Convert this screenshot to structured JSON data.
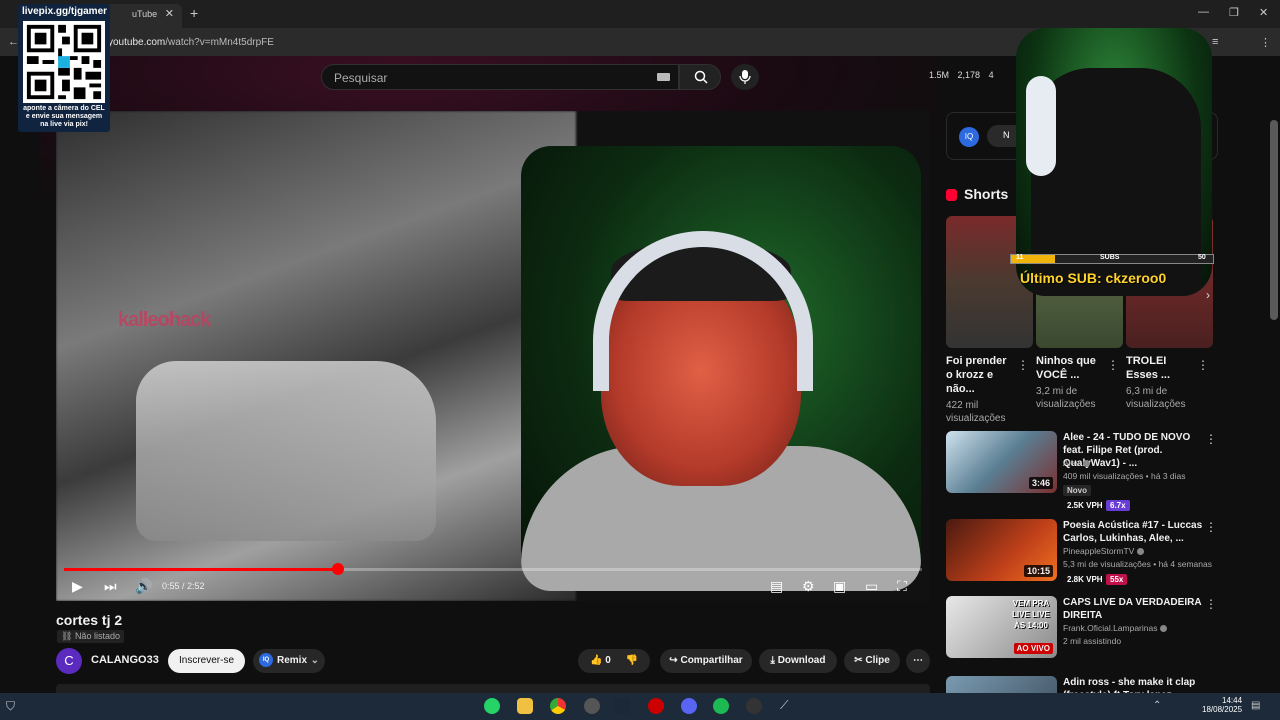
{
  "browser": {
    "tab_title": "uTube",
    "url_host": "youtube.com",
    "url_path": "/watch?v=mMn4t5drpFE"
  },
  "overlay_qr": {
    "title": "livepix.gg/tjgamer",
    "caption": "aponte a câmera do CEL e envie sua mensagem na live via pix!"
  },
  "header": {
    "search_placeholder": "Pesquisar",
    "stat_a": "1.5M",
    "stat_b": "2,178",
    "stat_c": "4"
  },
  "player": {
    "time": "0:55 / 2:52",
    "progress_fraction": 0.319,
    "watermark": "kalleohack"
  },
  "video": {
    "title": "cortes tj 2",
    "unlisted": "Não listado",
    "channel_initial": "C",
    "channel": "CALANGO33",
    "subscribe": "Inscrever-se",
    "remix": "Remix",
    "likes": "0",
    "share": "Compartilhar",
    "download": "Download",
    "clip": "Clipe"
  },
  "sidebar": {
    "ad_badge": "IQ",
    "ad_pill": "N",
    "shorts_heading": "Shorts",
    "shorts": [
      {
        "title": "Foi prender o krozz e não...",
        "views": "422 mil visualizações"
      },
      {
        "title": "Ninhos que VOCÊ ...",
        "views": "3,2 mi de visualizações"
      },
      {
        "title": "TROLEI Esses ...",
        "views": "6,3 mi de visualizações"
      }
    ],
    "recs": [
      {
        "title": "Alee - 24 - TUDO DE NOVO feat. Filipe Ret (prod. QualyWav1) - ...",
        "channel": "Alee",
        "meta": "409 mil visualizações • há 3 dias",
        "duration": "3:46",
        "tag": "Novo",
        "vph": "2.5K VPH",
        "mult": "6.7x"
      },
      {
        "title": "Poesia Acústica #17 - Luccas Carlos, Lukinhas, Alee, ...",
        "channel": "PineappleStormTV",
        "meta": "5,3 mi de visualizações • há 4 semanas",
        "duration": "10:15",
        "vph": "2.8K VPH",
        "mult": "55x"
      },
      {
        "title": "CAPS LIVE DA VERDADEIRA DIREITA",
        "channel": "Frank.Oficial.Lamparinas",
        "meta": "2 mil assistindo",
        "live": "AO VIVO",
        "thumb_text": "VEM PRA LIVE LIVE ÀS 14:00"
      },
      {
        "title": "Adin ross - she make it clap (freestyle) ft Tory lanez"
      }
    ]
  },
  "stream_overlay": {
    "sub_left": "11",
    "sub_mid": "SUBS",
    "sub_right": "50",
    "sub_fraction": 0.22,
    "last_sub": "Último SUB: ckzeroo0"
  },
  "taskbar": {
    "time": "14:44",
    "date": "18/08/2025"
  }
}
